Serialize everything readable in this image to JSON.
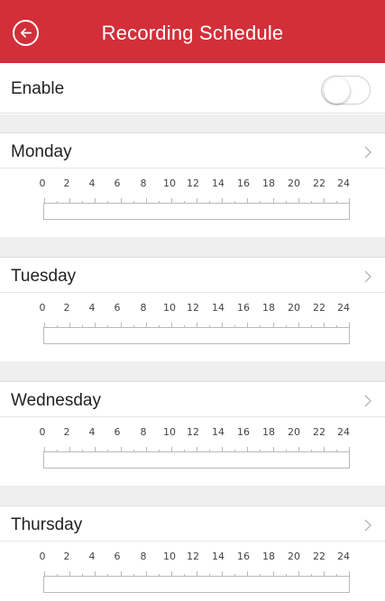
{
  "colors": {
    "brand": "#d32f3a",
    "separator": "#efefef"
  },
  "header": {
    "title": "Recording Schedule",
    "back_icon": "back-arrow-circle-icon"
  },
  "enable": {
    "label": "Enable",
    "enabled": false
  },
  "scale_labels": [
    "0",
    "2",
    "4",
    "6",
    "8",
    "10",
    "12",
    "14",
    "16",
    "18",
    "20",
    "22",
    "24"
  ],
  "days": [
    {
      "label": "Monday"
    },
    {
      "label": "Tuesday"
    },
    {
      "label": "Wednesday"
    },
    {
      "label": "Thursday"
    }
  ]
}
